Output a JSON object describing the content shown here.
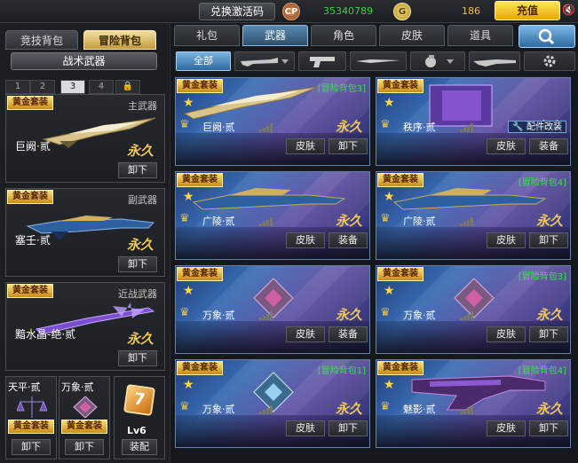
{
  "topbar": {
    "redeem_label": "兑换激活码",
    "cp_icon": "CP",
    "cp_value": "35340789",
    "gp_icon": "G",
    "gp_value": "186",
    "charge_label": "充值"
  },
  "left": {
    "bag_tabs": [
      "竞技背包",
      "冒险背包"
    ],
    "tactic_label": "战术武器",
    "num_tabs": [
      "1",
      "2",
      "3",
      "4"
    ],
    "slots": [
      {
        "label": "主武器",
        "weapon": "巨阙·贰",
        "gold": "黄金套装",
        "perm": "永久",
        "button": "卸下"
      },
      {
        "label": "副武器",
        "weapon": "塞壬·贰",
        "gold": "黄金套装",
        "perm": "永久",
        "button": "卸下"
      },
      {
        "label": "近战武器",
        "weapon": "黯水晶-绝·贰",
        "gold": "黄金套装",
        "perm": "永久",
        "button": "卸下"
      }
    ],
    "small_slots": [
      {
        "name": "天平·贰",
        "gold": "黄金套装",
        "button": "卸下"
      },
      {
        "name": "万象·贰",
        "gold": "黄金套装",
        "button": "卸下"
      }
    ],
    "level_icon": "7",
    "level": "Lv6",
    "level_button": "装配"
  },
  "tabs": [
    "礼包",
    "武器",
    "角色",
    "皮肤",
    "道具"
  ],
  "subtabs": {
    "all": "全部"
  },
  "cards": [
    {
      "gold": "黄金套装",
      "tag": "[冒险背包3]",
      "name": "巨阙·贰",
      "perm": "永久",
      "b1": "皮肤",
      "b2": "卸下",
      "badge": ""
    },
    {
      "gold": "黄金套装",
      "tag": "",
      "name": "秩序·贰",
      "perm": "永久",
      "b1": "皮肤",
      "b2": "装备",
      "badge": "配件改装"
    },
    {
      "gold": "黄金套装",
      "tag": "",
      "name": "广陵·贰",
      "perm": "永久",
      "b1": "皮肤",
      "b2": "装备",
      "badge": ""
    },
    {
      "gold": "黄金套装",
      "tag": "[冒险背包4]",
      "name": "广陵·贰",
      "perm": "永久",
      "b1": "皮肤",
      "b2": "卸下",
      "badge": ""
    },
    {
      "gold": "黄金套装",
      "tag": "",
      "name": "万象·贰",
      "perm": "永久",
      "b1": "皮肤",
      "b2": "装备",
      "badge": ""
    },
    {
      "gold": "黄金套装",
      "tag": "[冒险背包3]",
      "name": "万象·贰",
      "perm": "永久",
      "b1": "皮肤",
      "b2": "卸下",
      "badge": ""
    },
    {
      "gold": "黄金套装",
      "tag": "[冒险背包1]",
      "name": "万象·贰",
      "perm": "永久",
      "b1": "皮肤",
      "b2": "卸下",
      "badge": ""
    },
    {
      "gold": "黄金套装",
      "tag": "[冒险背包4]",
      "name": "魅影·贰",
      "perm": "永久",
      "b1": "皮肤",
      "b2": "卸下",
      "badge": ""
    }
  ]
}
